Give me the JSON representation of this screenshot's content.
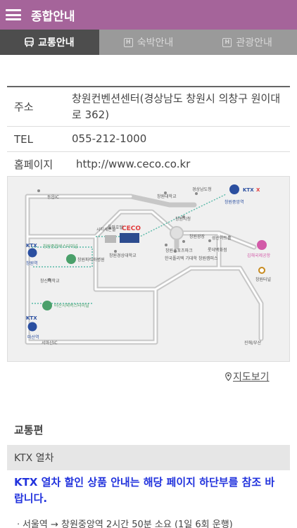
{
  "header": {
    "title": "종합안내"
  },
  "tabs": [
    {
      "label": "교통안내",
      "icon": "bus-icon",
      "active": true
    },
    {
      "label": "숙박안내",
      "icon": "hotel-icon",
      "active": false
    },
    {
      "label": "관광안내",
      "icon": "hotel-icon",
      "active": false
    }
  ],
  "info": {
    "address": {
      "label": "주소",
      "value": "창원컨벤션센터(경상남도 창원시 의창구 원이대로 362)"
    },
    "tel": {
      "label": "TEL",
      "value": "055-212-1000"
    },
    "homepage": {
      "label": "홈페이지",
      "value": "http://www.ceco.co.kr"
    }
  },
  "map": {
    "labels": {
      "dongeup_ic": "동읍IC",
      "gyeongnam_office": "경상남도청",
      "changwon_univ": "창원대학교",
      "changwon_jungang_station": "창원중앙역",
      "city_hall_sports": "시티세븐몰",
      "full_hotel": "풀만호텔",
      "ceco": "CECO",
      "changwon_city_hall": "창원시청",
      "changwon_square": "창원광장",
      "changwon_station": "창원역",
      "changwon_bus_terminal": "창원종합버스터미널",
      "changwon_hospital": "창원파티마병원",
      "changwon_gyeongsang_univ": "창원경상대학교",
      "hanguk_univ": "한국폴리텍 기대학 창원캠퍼스",
      "gimhae_airport": "김해국제공항",
      "changwon_terminal": "창원터널",
      "masan_univ": "창신대학교",
      "masan_bus_terminal": "마산시외버스터미널",
      "masan_station": "마산역",
      "seomasan_ic": "서마산IC",
      "jinhae_busan": "진해/부산",
      "ktx": "KTX",
      "ktx_x": "X",
      "seongsan_art": "성산아트홀",
      "changwon_sports_complex": "창원스포츠파크",
      "sangnam_market": "롯데백화점"
    }
  },
  "map_link": {
    "label": "지도보기"
  },
  "section": {
    "title": "교통편"
  },
  "ktx": {
    "header": "KTX 열차",
    "notice": "KTX 열차 할인 상품 안내는 해당 페이지 하단부를 참조 바랍니다.",
    "cut_line": "ㆍ서울역 → 창원중앙역 2시간 50분 소요 (1일 6회 운행)"
  }
}
